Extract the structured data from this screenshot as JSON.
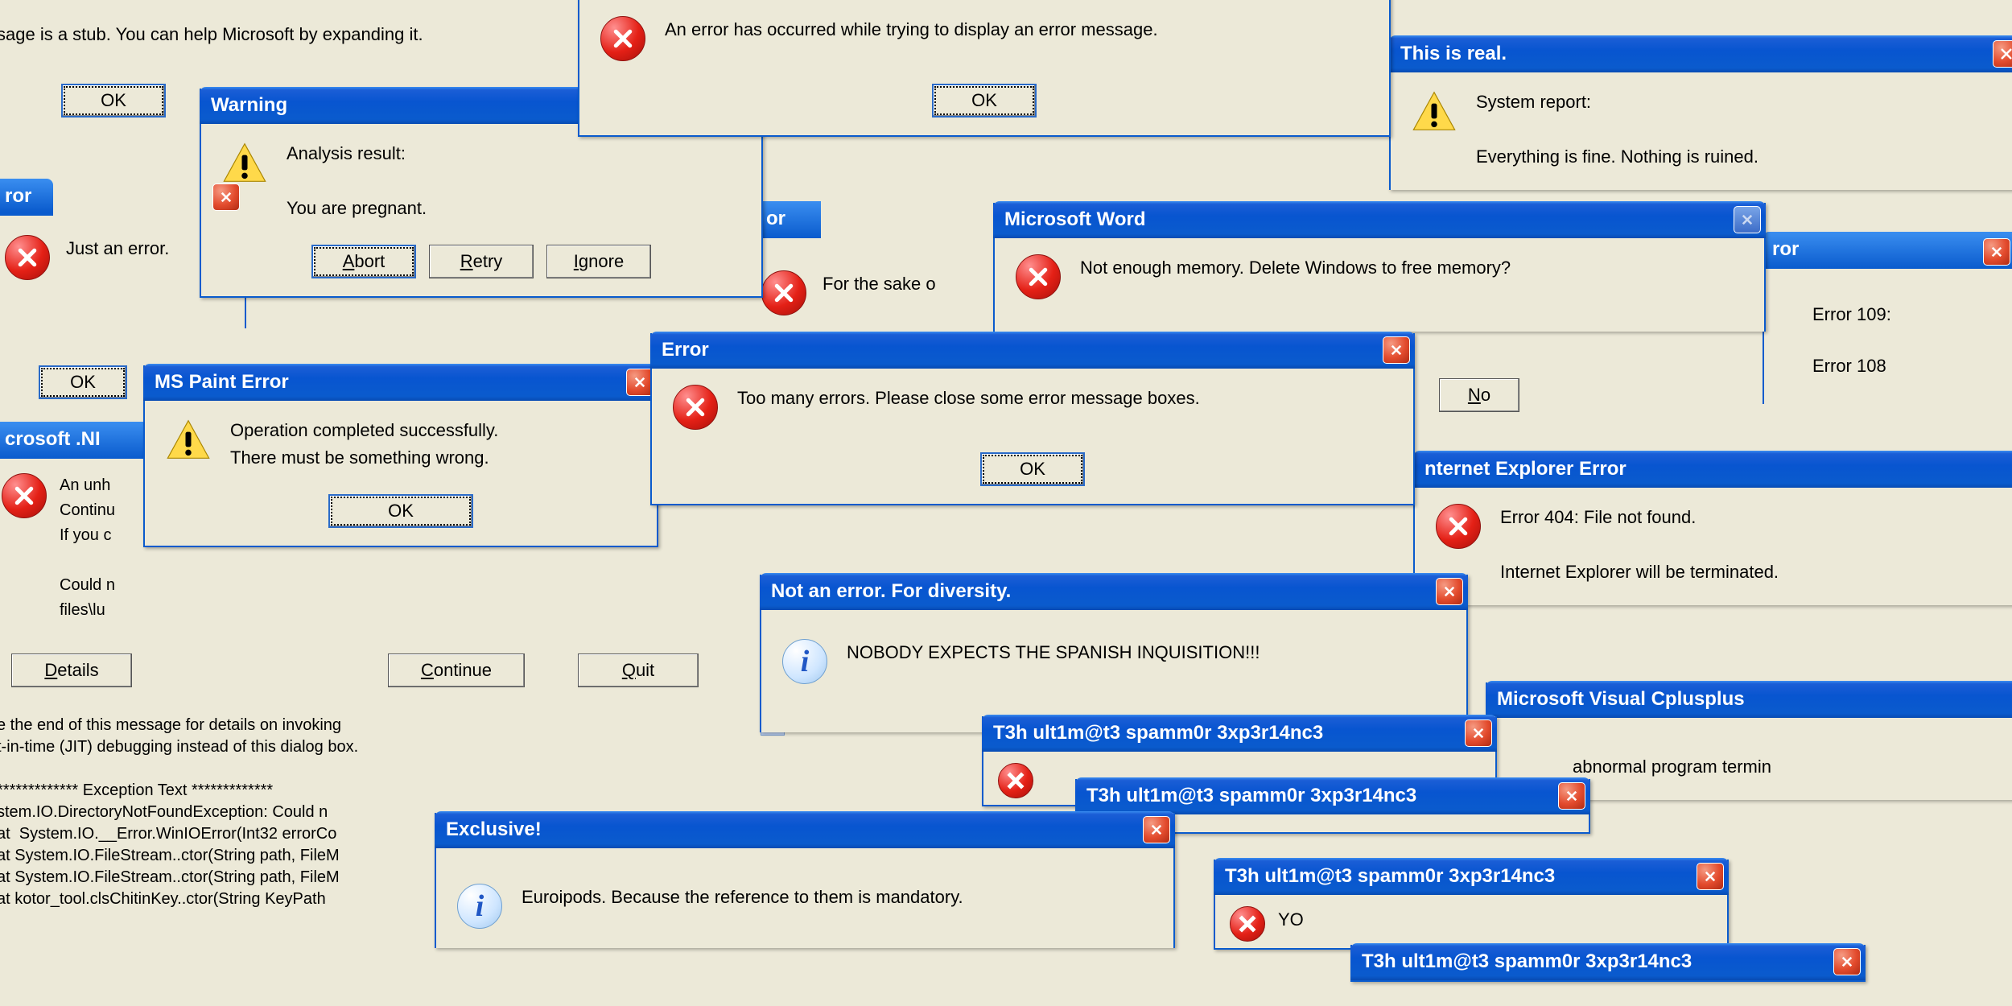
{
  "stub_text": "sage is a stub. You can help Microsoft by expanding it.",
  "stub_ok": "OK",
  "bg_left_ok": "OK",
  "bg_error_title_left": "ror",
  "bg_just_error": "Just an error.",
  "bg_dotnet_title": "crosoft .NI",
  "bg_dotnet_body": "An unh\nContinu\nIf you c\n\nCould n\nfiles\\lu",
  "bg_details": "Details",
  "bg_continue": "Continue",
  "bg_quit": "Quit",
  "bg_jit": "e the end of this message for details on invoking\nt-in-time (JIT) debugging instead of this dialog box.\n\n************* Exception Text *************\nstem.IO.DirectoryNotFoundException: Could n\nat  System.IO.__Error.WinIOError(Int32 errorCo\nat System.IO.FileStream..ctor(String path, FileM\nat System.IO.FileStream..ctor(String path, FileM\nat kotor_tool.clsChitinKey..ctor(String KeyPath",
  "bg_or_title": "or",
  "bg_for_sake": "For the sake o",
  "bg_right_error_title": "ror",
  "bg_err109": "Error 109:",
  "bg_err108": "Error 108",
  "bg_no": "No",
  "bg_yo": "YO",
  "top_error": {
    "msg": "An error has occurred while trying to display an error message.",
    "ok": "OK"
  },
  "this_real": {
    "title": "This is real.",
    "line1": "System report:",
    "line2": "Everything is fine. Nothing is ruined."
  },
  "warning": {
    "title": "Warning",
    "line1": "Analysis result:",
    "line2": "You are pregnant.",
    "abort": "Abort",
    "retry": "Retry",
    "ignore": "Ignore"
  },
  "word": {
    "title": "Microsoft Word",
    "msg": "Not enough memory. Delete Windows to free memory?"
  },
  "paint": {
    "title": "MS Paint Error",
    "msg": "Operation completed successfully.\nThere must be something wrong.",
    "ok": "OK"
  },
  "too_many": {
    "title": "Error",
    "msg": "Too many errors. Please close some error message boxes.",
    "ok": "OK"
  },
  "diversity": {
    "title": "Not an error. For diversity.",
    "msg": "NOBODY EXPECTS THE SPANISH INQUISITION!!!"
  },
  "ie": {
    "title": "nternet Explorer Error",
    "line1": "Error 404: File not found.",
    "line2": "Internet Explorer will be terminated."
  },
  "cpp": {
    "title": "Microsoft Visual Cplusplus",
    "msg": "abnormal program termin"
  },
  "exclusive": {
    "title": "Exclusive!",
    "msg": "Euroipods. Because the reference to them is mandatory."
  },
  "spam_title": "T3h ult1m@t3 spamm0r 3xp3r14nc3"
}
